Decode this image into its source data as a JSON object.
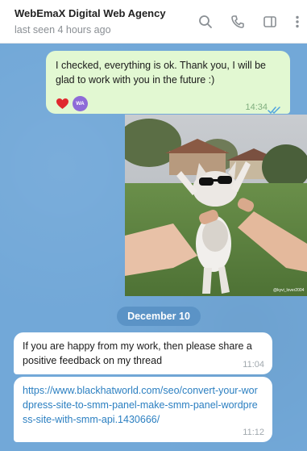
{
  "header": {
    "title": "WebEmaX Digital Web Agency",
    "status": "last seen 4 hours ago",
    "icons": [
      "search-icon",
      "phone-icon",
      "sidebar-icon",
      "more-icon"
    ]
  },
  "messages": [
    {
      "direction": "outgoing",
      "text": "I checked, everything is ok. Thank you, I will be glad to work with you in the future :)",
      "reactions": [
        "heart-icon",
        "WA"
      ],
      "time": "14:34",
      "read": true
    },
    {
      "direction": "outgoing",
      "type": "media",
      "watermark": "@kyvi_lover2004"
    },
    {
      "type": "date",
      "text": "December 10"
    },
    {
      "direction": "incoming",
      "text": "If you are happy from my work, then please share a positive feedback on my thread",
      "time": "11:04"
    },
    {
      "direction": "incoming",
      "text": "https://www.blackhatworld.com/seo/convert-your-wordpress-site-to-smm-panel-make-smm-panel-wordpress-site-with-smm-api.1430666/",
      "is_link": true,
      "time": "11:12"
    }
  ],
  "colors": {
    "chat_bg": "#72a8d8",
    "outgoing_bubble": "#e2f8d2",
    "incoming_bubble": "#ffffff",
    "link": "#2b7fc1",
    "date_pill": "#5b93c6"
  }
}
